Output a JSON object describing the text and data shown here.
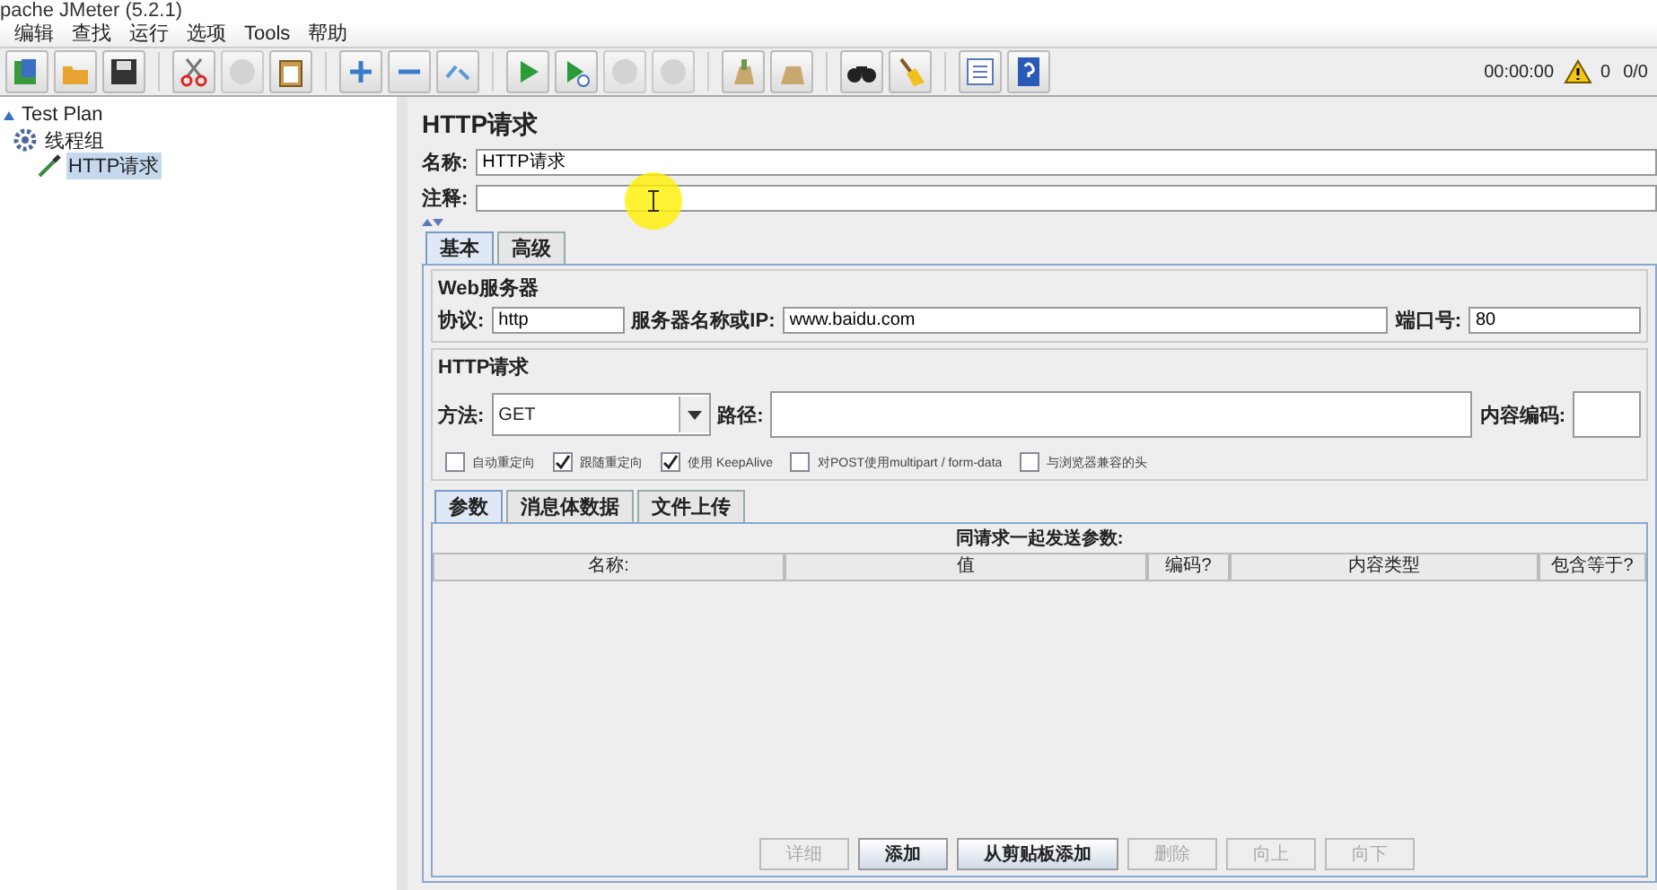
{
  "window": {
    "title": "pache JMeter (5.2.1)"
  },
  "menu": [
    "编辑",
    "查找",
    "运行",
    "选项",
    "Tools",
    "帮助"
  ],
  "toolbar": [
    {
      "disabled": false
    },
    {
      "disabled": false
    },
    {
      "disabled": false
    },
    {
      "disabled": false
    },
    {
      "disabled": true
    },
    {
      "disabled": false
    },
    {
      "disabled": false
    },
    {
      "disabled": false
    },
    {
      "disabled": false
    },
    {
      "disabled": false
    },
    {
      "disabled": false
    },
    {
      "disabled": true
    },
    {
      "disabled": true
    },
    {
      "disabled": false
    },
    {
      "disabled": false
    },
    {
      "disabled": false
    },
    {
      "disabled": false
    },
    {
      "disabled": false
    },
    {
      "disabled": false
    }
  ],
  "status": {
    "time": "00:00:00",
    "warnings": "0",
    "threads": "0/0"
  },
  "tree": {
    "label": "Test Plan",
    "expanded": true,
    "children": [
      {
        "label": "线程组",
        "expanded": true,
        "children": [
          {
            "label": "HTTP请求",
            "selected": true
          }
        ]
      }
    ]
  },
  "panel": {
    "title": "HTTP请求",
    "name_label": "名称:",
    "name_value": "HTTP请求",
    "comment_label": "注释:"
  },
  "tabs": [
    {
      "label": "基本",
      "selected": true
    },
    {
      "label": "高级",
      "selected": false
    }
  ],
  "web_server": {
    "legend": "Web服务器",
    "protocol_label": "协议:",
    "protocol": "http",
    "server_label": "服务器名称或IP:",
    "server": "www.baidu.com",
    "port_label": "端口号:",
    "port": "80"
  },
  "http_request": {
    "legend": "HTTP请求",
    "method_label": "方法:",
    "method": "GET",
    "path_label": "路径:",
    "encoding_label": "内容编码:",
    "options": [
      {
        "label": "自动重定向",
        "checked": false
      },
      {
        "label": "跟随重定向",
        "checked": true
      },
      {
        "label": "使用 KeepAlive",
        "checked": true
      },
      {
        "label": "对POST使用multipart / form-data",
        "checked": false
      },
      {
        "label": "与浏览器兼容的头",
        "checked": false
      }
    ]
  },
  "sub_tabs": [
    {
      "label": "参数",
      "selected": true
    },
    {
      "label": "消息体数据",
      "selected": false
    },
    {
      "label": "文件上传",
      "selected": false
    }
  ],
  "params": {
    "title": "同请求一起发送参数:",
    "columns": [
      "名称:",
      "值",
      "编码?",
      "内容类型",
      "包含等于?"
    ]
  },
  "buttons": [
    {
      "label": "详细",
      "disabled": true
    },
    {
      "label": "添加",
      "disabled": false
    },
    {
      "label": "从剪贴板添加",
      "disabled": false
    },
    {
      "label": "删除",
      "disabled": true
    },
    {
      "label": "向上",
      "disabled": true
    },
    {
      "label": "向下",
      "disabled": true
    }
  ]
}
